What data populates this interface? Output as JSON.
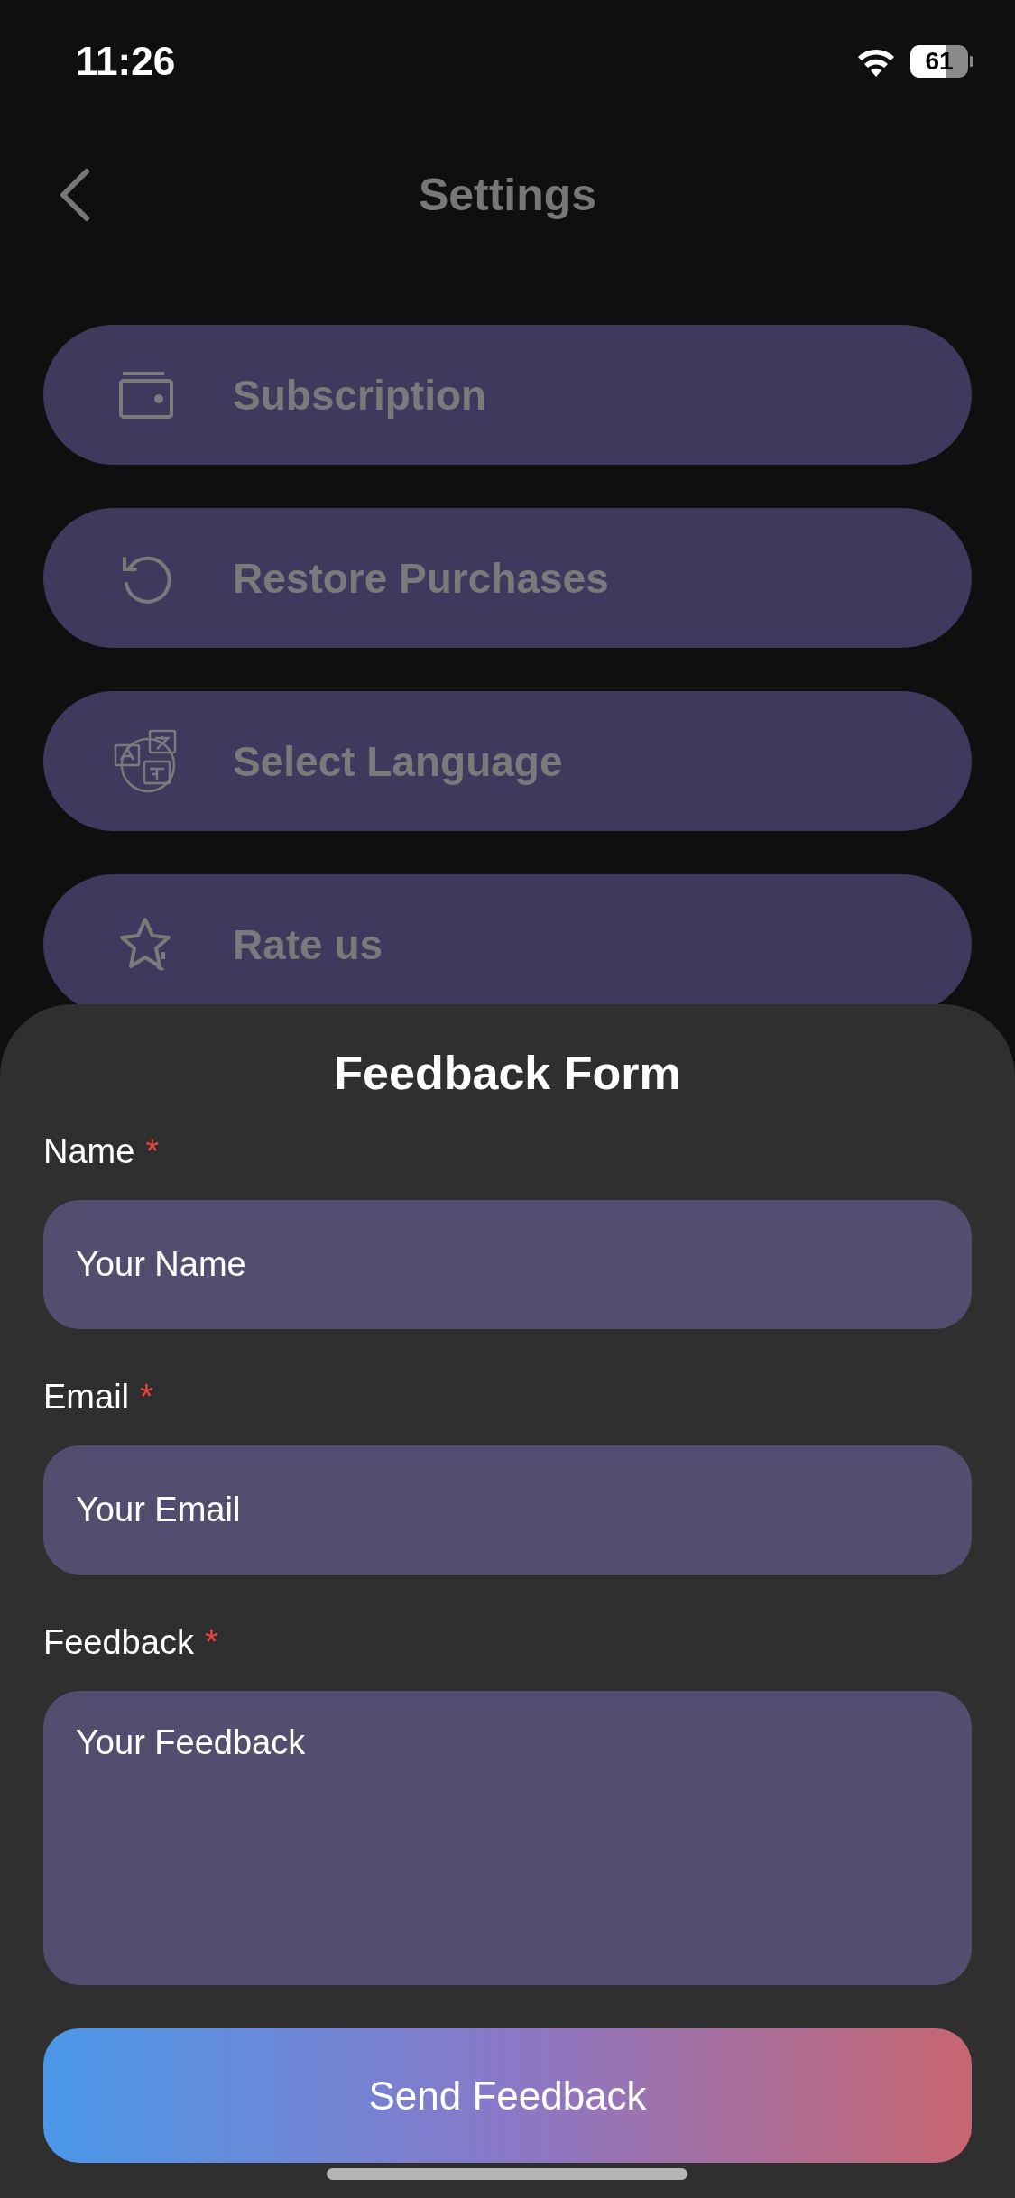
{
  "status_bar": {
    "time": "11:26",
    "battery": "61"
  },
  "header": {
    "title": "Settings"
  },
  "menu": [
    {
      "label": "Subscription"
    },
    {
      "label": "Restore Purchases"
    },
    {
      "label": "Select Language"
    },
    {
      "label": "Rate us"
    }
  ],
  "feedback_sheet": {
    "title": "Feedback Form",
    "fields": [
      {
        "kind": "single",
        "label": "Name",
        "marker": "*",
        "placeholder": "Your Name"
      },
      {
        "kind": "single",
        "label": "Email",
        "marker": "*",
        "placeholder": "Your Email"
      },
      {
        "kind": "multi",
        "label": "Feedback",
        "marker": "*",
        "placeholder": "Your Feedback"
      }
    ],
    "submit": "Send Feedback"
  }
}
